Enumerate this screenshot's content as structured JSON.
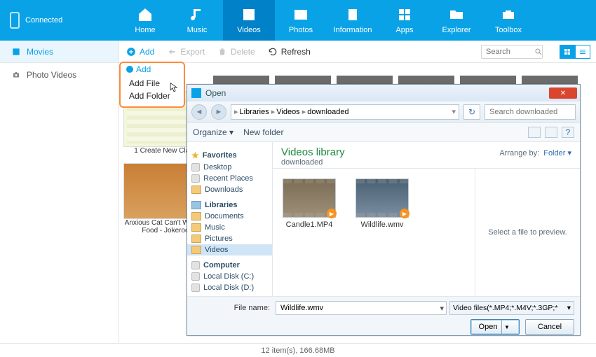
{
  "connected_label": "Connected",
  "nav": [
    {
      "label": "Home"
    },
    {
      "label": "Music"
    },
    {
      "label": "Videos"
    },
    {
      "label": "Photos"
    },
    {
      "label": "Information"
    },
    {
      "label": "Apps"
    },
    {
      "label": "Explorer"
    },
    {
      "label": "Toolbox"
    }
  ],
  "nav_active_index": 2,
  "sidebar_tab": "Movies",
  "sidebar_item": "Photo Videos",
  "toolbar": {
    "add": "Add",
    "export": "Export",
    "delete": "Delete",
    "refresh": "Refresh",
    "search_placeholder": "Search"
  },
  "add_menu": {
    "head": "Add",
    "items": [
      "Add File",
      "Add Folder"
    ]
  },
  "thumbs": {
    "a": "1 Create New Claim",
    "b": "Anxious Cat Can't Wait for Food - Jokeroo"
  },
  "dialog": {
    "title": "Open",
    "search_placeholder": "Search downloaded",
    "crumbs": [
      "Libraries",
      "Videos",
      "downloaded"
    ],
    "organize": "Organize",
    "newfolder": "New folder",
    "nav": {
      "favorites": "Favorites",
      "fav_items": [
        "Desktop",
        "Recent Places",
        "Downloads"
      ],
      "libraries": "Libraries",
      "lib_items": [
        "Documents",
        "Music",
        "Pictures",
        "Videos"
      ],
      "computer": "Computer",
      "comp_items": [
        "Local Disk (C:)",
        "Local Disk (D:)"
      ]
    },
    "lib_title": "Videos library",
    "lib_sub": "downloaded",
    "arrange_label": "Arrange by:",
    "arrange_value": "Folder",
    "files": [
      "Candle1.MP4",
      "Wildlife.wmv"
    ],
    "preview_hint": "Select a file to preview.",
    "filename_label": "File name:",
    "filename_value": "Wildlife.wmv",
    "filter": "Video files(*.MP4;*.M4V;*.3GP;*",
    "open": "Open",
    "cancel": "Cancel"
  },
  "status": "12 item(s), 166.68MB"
}
